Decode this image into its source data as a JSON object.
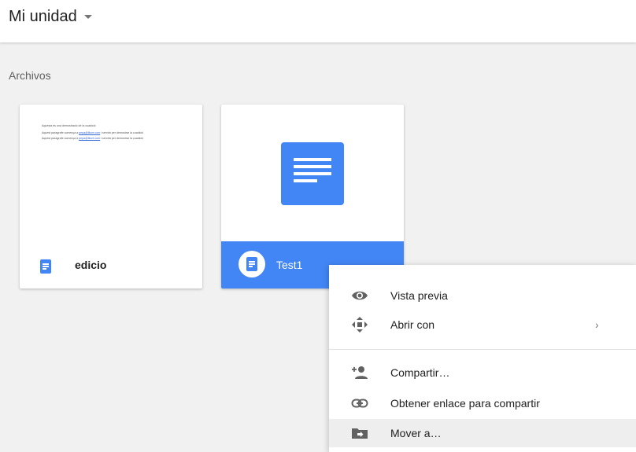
{
  "header": {
    "title": "Mi unidad"
  },
  "section": {
    "label": "Archivos"
  },
  "files": [
    {
      "name": "edicio",
      "preview_lines": [
        "Aquesta és una demostració de la cuadició",
        "Aquest paragrafe comença a ",
        "Aquest paragrafe comença a "
      ],
      "preview_links": [
        "pepa@lliure.com",
        "pepa@lliure.com"
      ],
      "preview_suffix": " i servirà per demostrar la cuadició"
    },
    {
      "name": "Test1"
    }
  ],
  "context_menu": {
    "items": [
      {
        "label": "Vista previa",
        "icon": "eye-icon"
      },
      {
        "label": "Abrir con",
        "icon": "move-arrows-icon",
        "has_submenu": true
      },
      {
        "label": "Compartir…",
        "icon": "add-person-icon"
      },
      {
        "label": "Obtener enlace para compartir",
        "icon": "link-icon"
      },
      {
        "label": "Mover a…",
        "icon": "move-to-folder-icon"
      }
    ],
    "submenu_arrow": "›"
  },
  "colors": {
    "accent": "#4285f4",
    "background": "#f1f1f1",
    "hover": "#eeeeee"
  }
}
